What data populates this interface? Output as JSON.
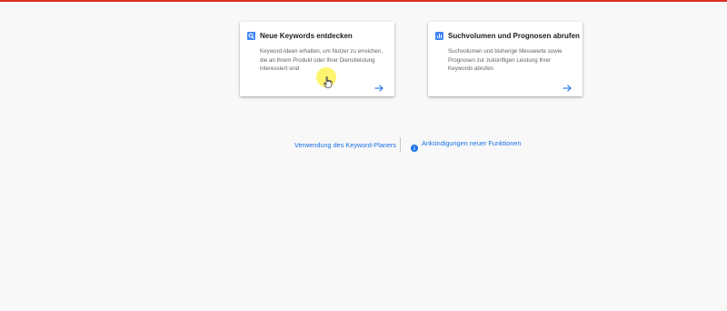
{
  "cards": [
    {
      "title": "Neue Keywords entdecken",
      "description": "Keyword-Ideen erhalten, um Nutzer zu erreichen, die an Ihrem Produkt oder Ihrer Dienstleistung interessiert sind",
      "icon": "search-icon"
    },
    {
      "title": "Suchvolumen und Prognosen abrufen",
      "description": "Suchvolumen und bisherige Messwerte sowie Prognosen zur zukünftigen Leistung Ihrer Keywords abrufen",
      "icon": "bar-chart-icon"
    }
  ],
  "links": {
    "how_to_use": "Verwendung des Keyword-Planers",
    "whats_new": "Ankündigungen neuer Funktionen"
  },
  "colors": {
    "accent": "#1a73e8",
    "icon_bg": "#4285f4",
    "top_bar": "#d93025",
    "cursor_highlight": "#fff03c"
  }
}
